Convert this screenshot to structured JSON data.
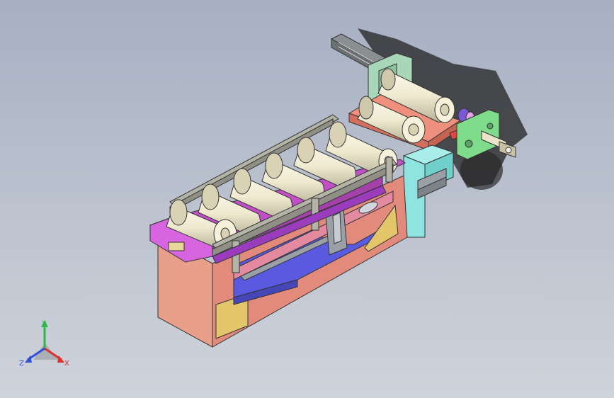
{
  "viewport": {
    "background_top": "#a6b0c2",
    "background_bottom": "#cfd3da"
  },
  "model": {
    "description_icon": "cad-assembly-feeder",
    "roller_count_main": 7,
    "roller_count_upper": 2,
    "colors": {
      "frame_front": "#e8a08a",
      "frame_top": "#e07d8f",
      "rail_purple": "#c34fc8",
      "rail_gray": "#b3b3a6",
      "roller": "#efe9cf",
      "blue_base": "#5a5ae0",
      "yellow_plate": "#e3c66a",
      "green_plate": "#7edc8a",
      "cyan_block": "#8fe3e0",
      "salmon_plate": "#ef8f7d"
    }
  },
  "triad": {
    "x_label": "X",
    "y_label": "Y",
    "z_label": "Z",
    "x_color": "#d9332b",
    "y_color": "#2fb54a",
    "z_color": "#2f4fd9"
  }
}
